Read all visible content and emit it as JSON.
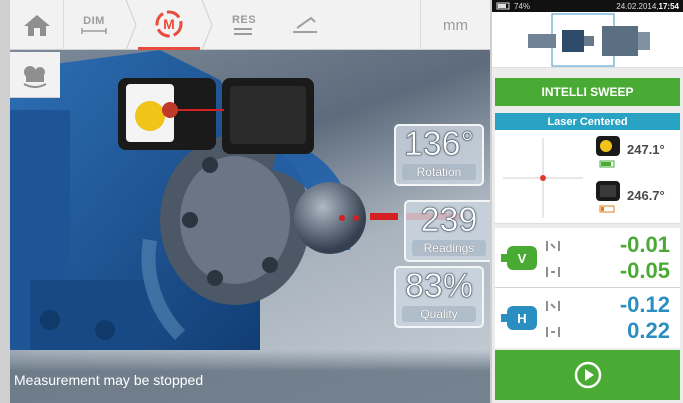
{
  "nav": {
    "dim_label": "DIM",
    "meas_label": "M",
    "res_label": "RES",
    "unit_label": "mm"
  },
  "status": {
    "battery": "74%",
    "datetime": "24.02.2014,",
    "time": "17:54"
  },
  "scene": {
    "rotation_value": "136°",
    "rotation_label": "Rotation",
    "readings_value": "239",
    "readings_label": "Readings",
    "quality_value": "83%",
    "quality_label": "Quality",
    "message": "Measurement may be stopped"
  },
  "panel": {
    "sweep_button": "INTELLI SWEEP",
    "laser_status": "Laser Centered",
    "sensor_angle": "247.1°",
    "laser_angle": "246.7°",
    "vertical": {
      "offset": "-0.01",
      "angle": "-0.05",
      "badge": "V"
    },
    "horizontal": {
      "offset": "-0.12",
      "angle": "0.22",
      "badge": "H"
    }
  },
  "colors": {
    "green": "#4aab34",
    "blue": "#29a3c3",
    "red": "#e74c3c"
  }
}
